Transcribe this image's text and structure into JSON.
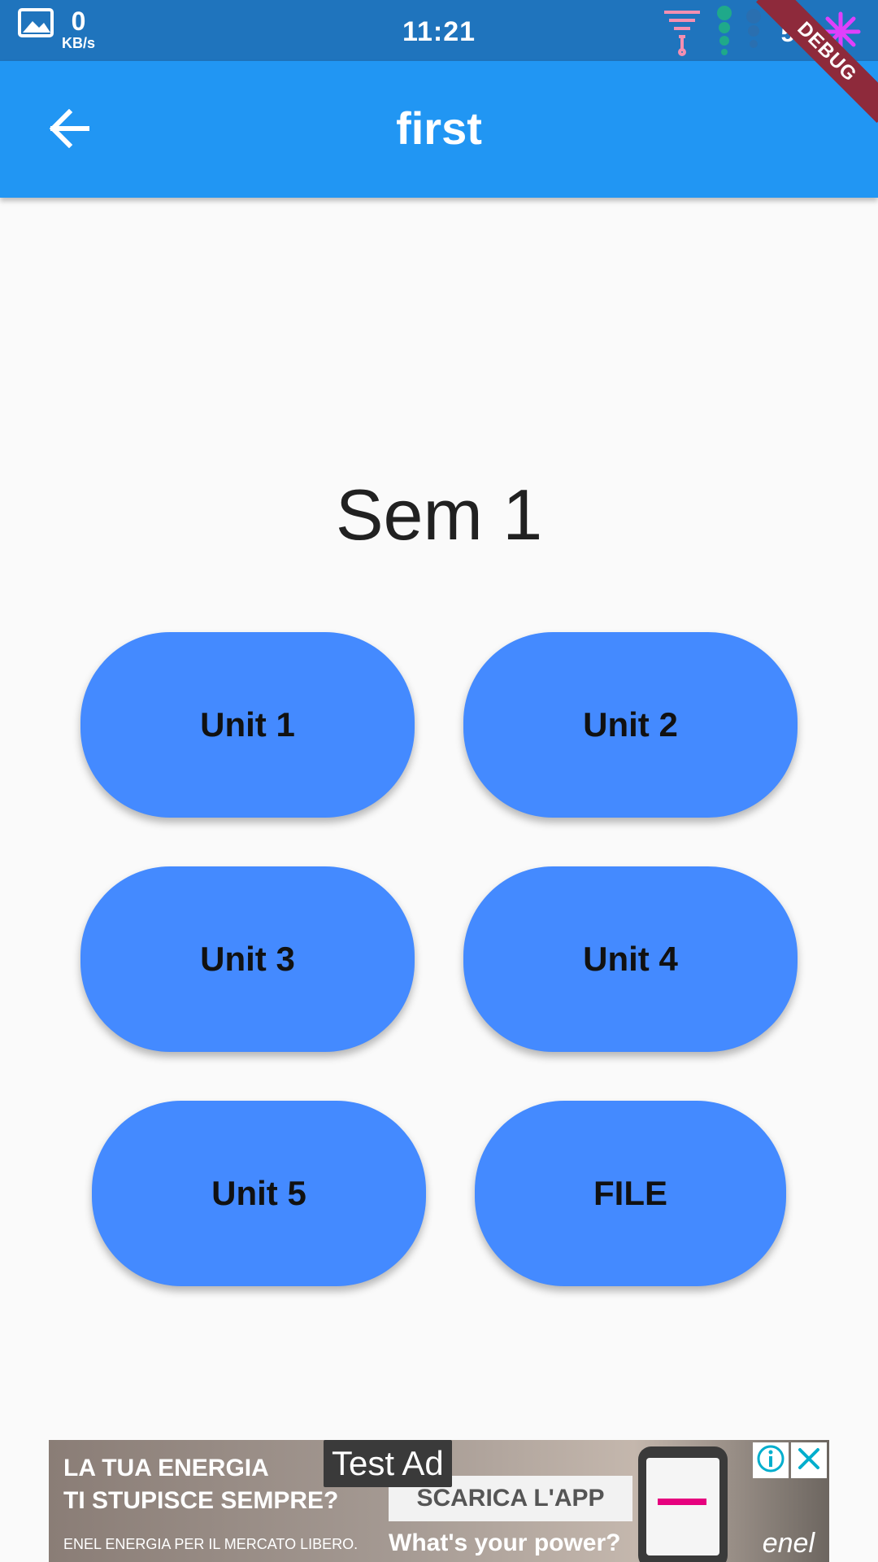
{
  "status_bar": {
    "speed_value": "0",
    "speed_unit": "KB/s",
    "time": "11:21",
    "battery": "58",
    "icons": [
      "image-icon",
      "signal-icon",
      "data-dots-icon",
      "battery-icon"
    ]
  },
  "debug_ribbon": {
    "label": "DEBUG"
  },
  "app_bar": {
    "title": "first",
    "back_icon": "arrow-left-icon"
  },
  "main": {
    "title": "Sem 1",
    "buttons": [
      {
        "label": "Unit 1"
      },
      {
        "label": "Unit 2"
      },
      {
        "label": "Unit 3"
      },
      {
        "label": "Unit 4"
      },
      {
        "label": "Unit 5"
      },
      {
        "label": "FILE"
      }
    ]
  },
  "ad": {
    "badge": "Test Ad",
    "headline_line1": "LA TUA ENERGIA",
    "headline_line2": "TI STUPISCE SEMPRE?",
    "small_text": "ENEL ENERGIA PER IL MERCATO LIBERO.",
    "cta": "SCARICA L'APP",
    "tagline": "What's your power?",
    "brand": "enel",
    "info_icon": "info-icon",
    "close_icon": "close-icon"
  },
  "colors": {
    "status_bar": "#1f74bd",
    "app_bar": "#2196f3",
    "button": "#448aff",
    "background": "#fafafa",
    "debug": "#8e2a3b"
  }
}
